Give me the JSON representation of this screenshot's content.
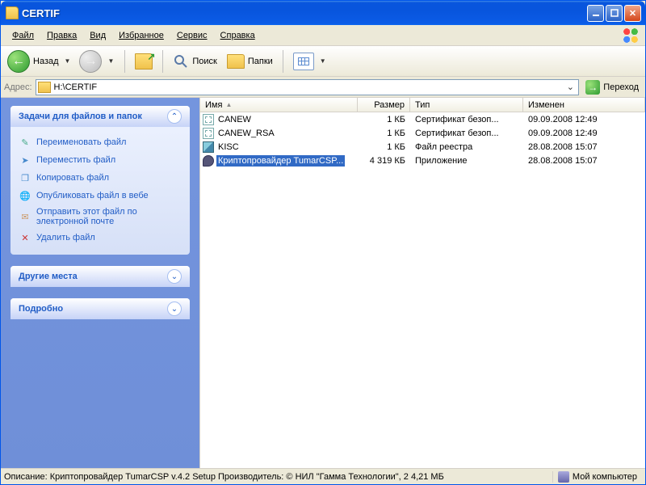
{
  "window": {
    "title": "CERTIF"
  },
  "menu": {
    "file": "Файл",
    "edit": "Правка",
    "view": "Вид",
    "favorites": "Избранное",
    "tools": "Сервис",
    "help": "Справка"
  },
  "toolbar": {
    "back": "Назад",
    "search": "Поиск",
    "folders": "Папки"
  },
  "address": {
    "label": "Адрес:",
    "value": "H:\\CERTIF",
    "go": "Переход"
  },
  "sidebar": {
    "tasks_title": "Задачи для файлов и папок",
    "tasks": [
      {
        "label": "Переименовать файл",
        "icon": "rename",
        "color": "#4a8"
      },
      {
        "label": "Переместить файл",
        "icon": "move",
        "color": "#48c"
      },
      {
        "label": "Копировать файл",
        "icon": "copy",
        "color": "#48c"
      },
      {
        "label": "Опубликовать файл в вебе",
        "icon": "publish",
        "color": "#2a6"
      },
      {
        "label": "Отправить этот файл по электронной почте",
        "icon": "email",
        "color": "#c96"
      },
      {
        "label": "Удалить файл",
        "icon": "delete",
        "color": "#c33"
      }
    ],
    "other_title": "Другие места",
    "details_title": "Подробно"
  },
  "columns": {
    "name": "Имя",
    "size": "Размер",
    "type": "Тип",
    "modified": "Изменен"
  },
  "files": [
    {
      "name": "CANEW",
      "size": "1 КБ",
      "type": "Сертификат безоп...",
      "modified": "09.09.2008 12:49",
      "icon": "cert",
      "selected": false
    },
    {
      "name": "CANEW_RSA",
      "size": "1 КБ",
      "type": "Сертификат безоп...",
      "modified": "09.09.2008 12:49",
      "icon": "cert",
      "selected": false
    },
    {
      "name": "KISC",
      "size": "1 КБ",
      "type": "Файл реестра",
      "modified": "28.08.2008 15:07",
      "icon": "reg",
      "selected": false
    },
    {
      "name": "Криптопровайдер TumarCSP...",
      "size": "4 319 КБ",
      "type": "Приложение",
      "modified": "28.08.2008 15:07",
      "icon": "app",
      "selected": true
    }
  ],
  "status": {
    "main": "Описание: Криптопровайдер TumarCSP v.4.2 Setup Производитель: © НИЛ \"Гамма Технологии\", 2 4,21 МБ",
    "right": "Мой компьютер"
  }
}
